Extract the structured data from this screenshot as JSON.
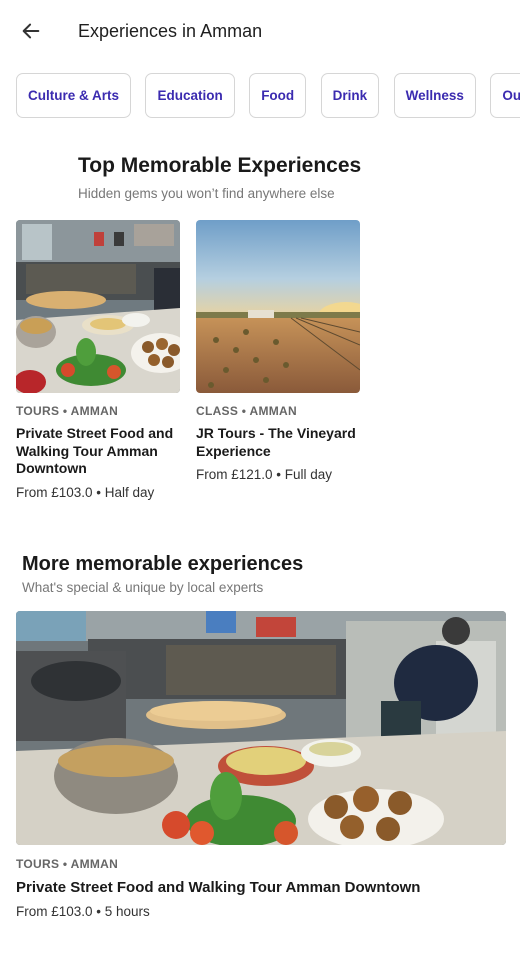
{
  "header": {
    "title": "Experiences in Amman",
    "back_icon": "arrow-left-icon"
  },
  "categories": [
    {
      "label": "Culture & Arts"
    },
    {
      "label": "Education"
    },
    {
      "label": "Food"
    },
    {
      "label": "Drink"
    },
    {
      "label": "Wellness"
    },
    {
      "label": "Outdoor"
    }
  ],
  "top_section": {
    "title": "Top Memorable Experiences",
    "subtitle": "Hidden gems you won’t find anywhere else",
    "cards": [
      {
        "meta": "TOURS • AMMAN",
        "title": "Private Street Food and Walking Tour Amman Downtown",
        "price": "From £103.0 • Half day"
      },
      {
        "meta": "CLASS • AMMAN",
        "title": "JR Tours - The Vineyard Experience",
        "price": "From £121.0 • Full day"
      }
    ]
  },
  "more_section": {
    "title": "More memorable experiences",
    "subtitle": "What's special & unique by local experts",
    "card": {
      "meta": "TOURS • AMMAN",
      "title": "Private Street Food and Walking Tour Amman Downtown",
      "price": "From £103.0 • 5 hours"
    }
  },
  "colors": {
    "accent": "#3b2bb0",
    "chip_border": "#d6d6d6",
    "muted_text": "#777777"
  }
}
